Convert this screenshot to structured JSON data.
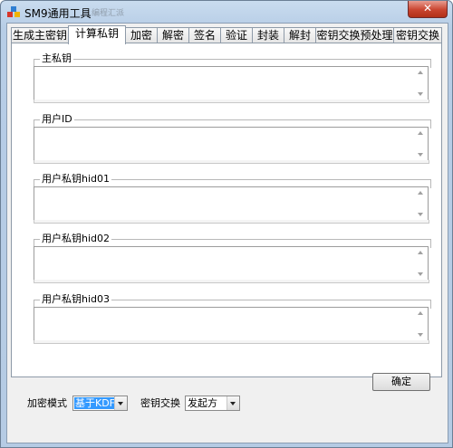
{
  "window": {
    "title": "SM9通用工具",
    "ghost_title": "编程汇派",
    "close_glyph": "✕"
  },
  "tabs": [
    {
      "label": "生成主密钥"
    },
    {
      "label": "计算私钥"
    },
    {
      "label": "加密"
    },
    {
      "label": "解密"
    },
    {
      "label": "签名"
    },
    {
      "label": "验证"
    },
    {
      "label": "封装"
    },
    {
      "label": "解封"
    },
    {
      "label": "密钥交换预处理"
    },
    {
      "label": "密钥交换"
    }
  ],
  "active_tab": "计算私钥",
  "groups": [
    {
      "label": "主私钥",
      "value": ""
    },
    {
      "label": "用户ID",
      "value": ""
    },
    {
      "label": "用户私钥hid01",
      "value": ""
    },
    {
      "label": "用户私钥hid02",
      "value": ""
    },
    {
      "label": "用户私钥hid03",
      "value": ""
    }
  ],
  "ok_button": "确定",
  "bottom": {
    "encrypt_mode_label": "加密模式",
    "encrypt_mode_value": "基于KDF",
    "key_exchange_label": "密钥交换",
    "key_exchange_value": "发起方"
  },
  "colors": {
    "selection": "#3399ff",
    "close_button": "#c9442f"
  }
}
